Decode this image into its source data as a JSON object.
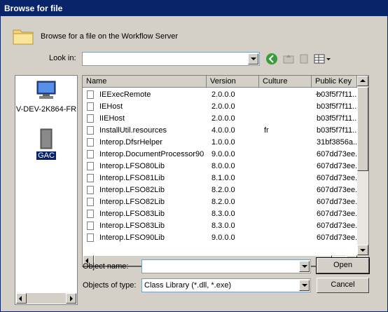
{
  "window": {
    "title": "Browse for file"
  },
  "header": {
    "text": "Browse for a file on the Workflow Server"
  },
  "lookin": {
    "label": "Look in:",
    "value": ""
  },
  "places": [
    {
      "label": "V-DEV-2K864-FR",
      "icon": "computer-icon"
    },
    {
      "label": "GAC",
      "icon": "gac-icon"
    }
  ],
  "columns": [
    {
      "label": "Name"
    },
    {
      "label": "Version"
    },
    {
      "label": "Culture"
    },
    {
      "label": "Public Key ..."
    }
  ],
  "rows": [
    {
      "name": "IEExecRemote",
      "version": "2.0.0.0",
      "culture": "",
      "key": "b03f5f7f11..."
    },
    {
      "name": "IEHost",
      "version": "2.0.0.0",
      "culture": "",
      "key": "b03f5f7f11..."
    },
    {
      "name": "IIEHost",
      "version": "2.0.0.0",
      "culture": "",
      "key": "b03f5f7f11..."
    },
    {
      "name": "InstallUtil.resources",
      "version": "4.0.0.0",
      "culture": "fr",
      "key": "b03f5f7f11..."
    },
    {
      "name": "Interop.DfsrHelper",
      "version": "1.0.0.0",
      "culture": "",
      "key": "31bf3856a..."
    },
    {
      "name": "Interop.DocumentProcessor90",
      "version": "9.0.0.0",
      "culture": "",
      "key": "607dd73ee..."
    },
    {
      "name": "Interop.LFSO80Lib",
      "version": "8.0.0.0",
      "culture": "",
      "key": "607dd73ee..."
    },
    {
      "name": "Interop.LFSO81Lib",
      "version": "8.1.0.0",
      "culture": "",
      "key": "607dd73ee..."
    },
    {
      "name": "Interop.LFSO82Lib",
      "version": "8.2.0.0",
      "culture": "",
      "key": "607dd73ee..."
    },
    {
      "name": "Interop.LFSO82Lib",
      "version": "8.2.0.0",
      "culture": "",
      "key": "607dd73ee..."
    },
    {
      "name": "Interop.LFSO83Lib",
      "version": "8.3.0.0",
      "culture": "",
      "key": "607dd73ee..."
    },
    {
      "name": "Interop.LFSO83Lib",
      "version": "8.3.0.0",
      "culture": "",
      "key": "607dd73ee..."
    },
    {
      "name": "Interop.LFSO90Lib",
      "version": "9.0.0.0",
      "culture": "",
      "key": "607dd73ee..."
    }
  ],
  "objectName": {
    "label": "Object name:",
    "value": ""
  },
  "objectType": {
    "label": "Objects of type:",
    "value": "Class Library (*.dll, *.exe)"
  },
  "buttons": {
    "open": "Open",
    "cancel": "Cancel"
  },
  "colors": {
    "titlebar": "#0a246a",
    "face": "#d4d0c8",
    "selection": "#0a246a"
  }
}
